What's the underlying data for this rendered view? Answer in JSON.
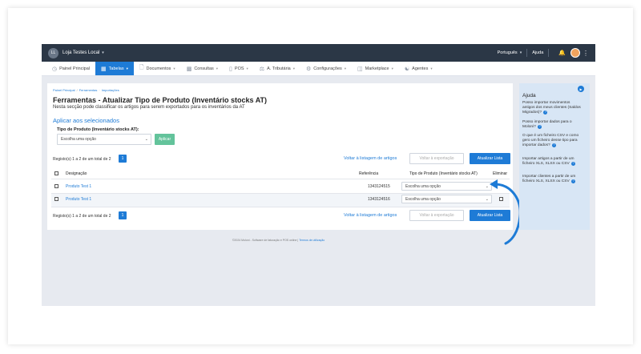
{
  "topbar": {
    "avatar_initials": "LL",
    "store_name": "Loja Testes Local",
    "language": "Português",
    "help": "Ajuda"
  },
  "menu": [
    {
      "label": "Painel Principal",
      "icon": "dashboard-icon",
      "active": false,
      "chevron": false
    },
    {
      "label": "Tabelas",
      "icon": "table-icon",
      "active": true,
      "chevron": true
    },
    {
      "label": "Documentos",
      "icon": "document-icon",
      "active": false,
      "chevron": true
    },
    {
      "label": "Consultas",
      "icon": "chart-icon",
      "active": false,
      "chevron": true
    },
    {
      "label": "POS",
      "icon": "pos-icon",
      "active": false,
      "chevron": true
    },
    {
      "label": "A. Tributária",
      "icon": "tax-icon",
      "active": false,
      "chevron": true
    },
    {
      "label": "Configurações",
      "icon": "settings-icon",
      "active": false,
      "chevron": true
    },
    {
      "label": "Marketplace",
      "icon": "marketplace-icon",
      "active": false,
      "chevron": true
    },
    {
      "label": "Agentes",
      "icon": "agents-icon",
      "active": false,
      "chevron": true
    }
  ],
  "breadcrumb": [
    "Painel Principal",
    "Ferramentas",
    "Importações"
  ],
  "page": {
    "title": "Ferramentas - Atualizar Tipo de Produto (Inventário stocks AT)",
    "subtitle": "Nesta secção pode classificar os artigos para serem exportados para os inventários da AT",
    "section": "Aplicar aos selecionados",
    "field_label": "Tipo de Produto (Inventário stocks AT):",
    "select_placeholder": "Escolha uma opção",
    "apply_label": "Aplicar"
  },
  "pagination": {
    "records_text": "Registo(s) 1 a 2 de um total de 2",
    "page": "1",
    "back_link": "Voltar à listagem de artigos",
    "export_label": "Voltar à exportação",
    "update_label": "Atualizar Lista"
  },
  "table": {
    "headers": {
      "designation": "Designação",
      "reference": "Referência",
      "type": "Tipo de Produto (Inventário stocks AT)",
      "delete": "Eliminar"
    },
    "rows": [
      {
        "name": "Produto Test 1",
        "reference": "1343124515",
        "type": "Escolha uma opção"
      },
      {
        "name": "Produto Test 1",
        "reference": "1343124516",
        "type": "Escolha uma opção"
      }
    ]
  },
  "footer": {
    "text": "©2024 Moloni - Software de faturação e POS online |",
    "link": "Termos de utilização"
  },
  "help_panel": {
    "title": "Ajuda",
    "items": [
      "Posso importar movimentos antigos dos meus clientes (Saldos Migrados)?",
      "Posso importar dados para o Moloni?",
      "O que é um ficheiro CSV e como gero um ficheiro desse tipo para importar dados?",
      "Importar artigos a partir de um ficheiro XLS, XLSX ou CSV",
      "Importar clientes a partir de um ficheiro XLS, XLSX ou CSV"
    ]
  },
  "colors": {
    "primary": "#1e7bd6",
    "topbar": "#2b3746",
    "apply": "#63c39b",
    "help_bg": "#d8e6f5"
  }
}
